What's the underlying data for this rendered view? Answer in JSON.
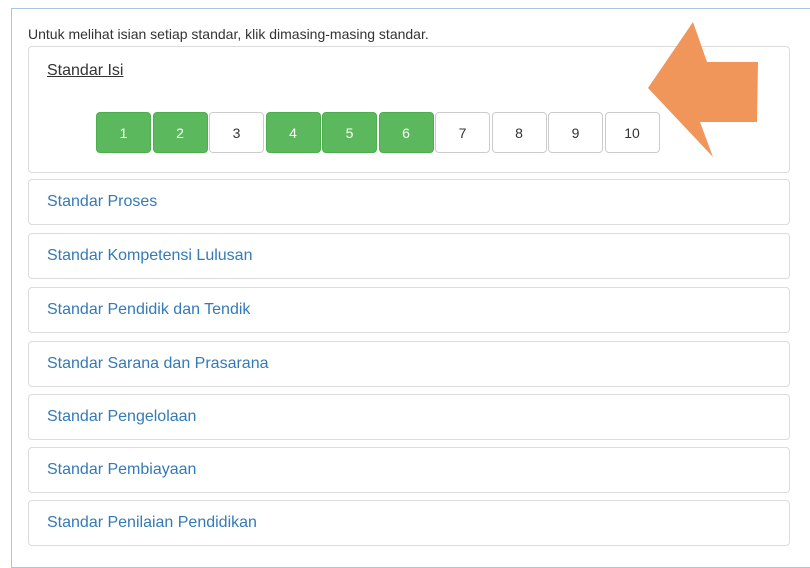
{
  "intro_text": "Untuk melihat isian setiap standar, klik dimasing-masing standar.",
  "open_panel": {
    "title": "Standar Isi",
    "pages": [
      {
        "label": "1",
        "state": "done"
      },
      {
        "label": "2",
        "state": "done"
      },
      {
        "label": "3",
        "state": "empty"
      },
      {
        "label": "4",
        "state": "done"
      },
      {
        "label": "5",
        "state": "done"
      },
      {
        "label": "6",
        "state": "done"
      },
      {
        "label": "7",
        "state": "empty"
      },
      {
        "label": "8",
        "state": "empty"
      },
      {
        "label": "9",
        "state": "empty"
      },
      {
        "label": "10",
        "state": "empty"
      }
    ]
  },
  "panels": [
    {
      "title": "Standar Proses"
    },
    {
      "title": "Standar Kompetensi Lulusan"
    },
    {
      "title": "Standar Pendidik dan Tendik"
    },
    {
      "title": "Standar Sarana dan Prasarana"
    },
    {
      "title": "Standar Pengelolaan"
    },
    {
      "title": "Standar Pembiayaan"
    },
    {
      "title": "Standar Penilaian Pendidikan"
    }
  ],
  "colors": {
    "done": "#5cb85c",
    "link": "#337ab7",
    "arrow": "#f0965a",
    "frame_border": "#a9c5e6"
  },
  "annotation": {
    "icon": "arrow-pointer-icon"
  }
}
